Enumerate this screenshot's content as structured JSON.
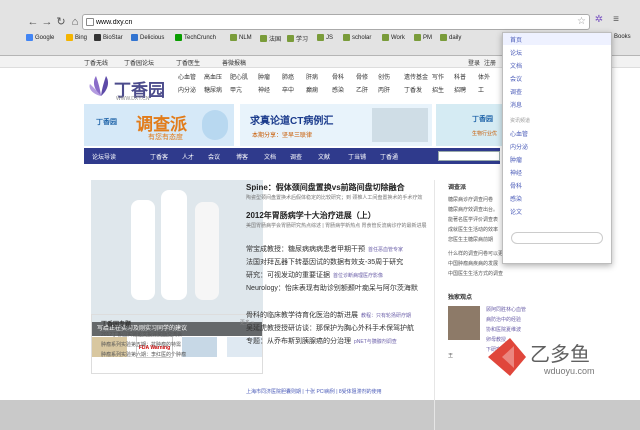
{
  "browser": {
    "url": "www.dxy.cn",
    "bookmarks": [
      "Google",
      "Bing",
      "BioStar",
      "Delicious",
      "TechCrunch",
      "NLM",
      "法国",
      "学习",
      "JS",
      "scholar",
      "Work",
      "PM",
      "daily",
      "Books"
    ]
  },
  "topbar": {
    "links": [
      "丁香无线",
      "丁香园论坛",
      "丁香医生",
      "善微报稿"
    ],
    "right": [
      "登录",
      "注册",
      "第"
    ]
  },
  "logo": {
    "text": "丁香园",
    "url": "WWW.DXY.CN"
  },
  "categories": [
    [
      "心血管",
      "高血压",
      "肥心肌",
      "肿瘤",
      "肺癌",
      "肝病",
      "骨科",
      "骨修",
      "创伤",
      "遗传基金",
      "写作",
      "科普",
      "体外"
    ],
    [
      "内分泌",
      "糖尿病",
      "甲亢",
      "神经",
      "卒中",
      "癫痫",
      "感染",
      "乙肝",
      "丙肝",
      "丁香发",
      "招生",
      "招聘",
      "工"
    ]
  ],
  "banners": {
    "b1_title": "丁香园",
    "b1_big": "调查派",
    "b1_small": "有您有态度",
    "b2_title": "求真论道CT病例汇",
    "b2_small": "本期分享：坚早三联律",
    "b3_title": "丁香园",
    "b3_small": "生物行业优"
  },
  "mainnav": [
    "论坛导读",
    "丁香客",
    "人才",
    "会议",
    "博客",
    "文档",
    "调查",
    "文献",
    "丁当铺",
    "丁香通"
  ],
  "feature": {
    "caption": "写给正在实习及刚实习同学的建议",
    "thumb_text": "FDA Warning"
  },
  "sidebox": {
    "title": "丁香园专题",
    "more": "更多 »",
    "lines": [
      "2012丁香园实验论文投评奖励交流会",
      "肿瘤系列实验第五期：抗肿瘤的特需",
      "肿瘤系列实验第六期：李红医的个肿瘤"
    ]
  },
  "news": {
    "h1": "Spine：假体颈间盘置换vs前路间盘切除融合",
    "h1_sub": "陶瓷型颈间盘置换术后假体稳定的比较研究；到   颈椎人工间盘置换术的手术疗效",
    "h2": "2012年胃肠病学十大治疗进展（上）",
    "h2_sub": "美国胃肠病学会胃肠研究热点综述 | 胃肠病学新热点  胃食管反流病诊疗的最新进展",
    "lines": [
      {
        "text": "常宝成教授：糖尿病病病患者甲期干预",
        "tag": "首任恶血管专家"
      },
      {
        "text": "法国对拜瓦器下转基因试的数据有效支-35周于研究",
        "tag": ""
      },
      {
        "text": "研究：可视发动的重要证据",
        "tag": "首位诊断病理医疗影像"
      },
      {
        "text": "Neurology：怡床表现有助诊别额颞叶痴呆与阿尔茨海默",
        "tag": ""
      }
    ],
    "lines2": [
      {
        "text": "骨科的临床教学待育化医治的新进展",
        "tag": "教程：只有轮扬研疗期"
      },
      {
        "text": "吴延虎教授授研访谈：那保护为胸心外科手术保驾护航",
        "tag": ""
      },
      {
        "text": "专题：从乔布斯到胰腺癌的分治理",
        "tag": "pNET与胰腺剂调查"
      }
    ],
    "footer": "上海市同济医院胆囊则期 | 十张 PCI病例 | 8受体阻滞剂的使用"
  },
  "right": {
    "survey_title": "调查派",
    "survey_sub": "糖尿病诊疗调查问卷",
    "survey_lines": [
      "糖尿病疗效调查出台。",
      "能著名医学评价调查表",
      "成就医生生活动的效率",
      "您医生主糖尿病前期"
    ],
    "list": [
      "什么样的调查问卷可以更好",
      "中国肿瘤病疾病的发展",
      "中国医生生活方式的调查"
    ],
    "view_title": "独家观点",
    "view_lines": [
      "顾阿同胜林心血管",
      "病防治中的经验",
      "协和医院夏维波",
      "卵母教授",
      "下研究"
    ],
    "view_more": [
      "王"
    ]
  },
  "dropdown": {
    "items1": [
      "首页",
      "论坛",
      "文档",
      "会议",
      "调查",
      "消息"
    ],
    "label": "资讯频道",
    "items2": [
      "心血管",
      "内分泌",
      "肿瘤",
      "神经",
      "骨科",
      "感染",
      "论文"
    ],
    "selected": "首页"
  },
  "watermark": {
    "text": "乙多鱼",
    "url": "wduoyu.com"
  },
  "colors": {
    "navy": "#2f3a8c",
    "link": "#4a5bb8",
    "purple": "#6a5ea8",
    "brand": "#7b55c2"
  }
}
